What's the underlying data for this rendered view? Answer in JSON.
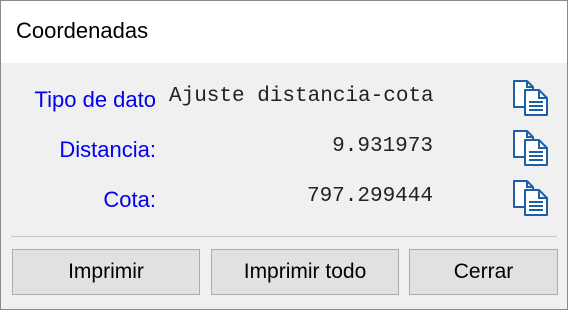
{
  "window": {
    "title": "Coordenadas"
  },
  "rows": [
    {
      "label": "Tipo de dato",
      "value": "Ajuste distancia-cota",
      "copy_icon": "copy-icon"
    },
    {
      "label": "Distancia:",
      "value": "9.931973",
      "copy_icon": "copy-icon"
    },
    {
      "label": "Cota:",
      "value": "797.299444",
      "copy_icon": "copy-icon"
    }
  ],
  "buttons": {
    "print": "Imprimir",
    "print_all": "Imprimir todo",
    "close": "Cerrar"
  },
  "colors": {
    "label": "#0000ee",
    "icon": "#1e5fa8",
    "background": "#f0f0f0"
  }
}
